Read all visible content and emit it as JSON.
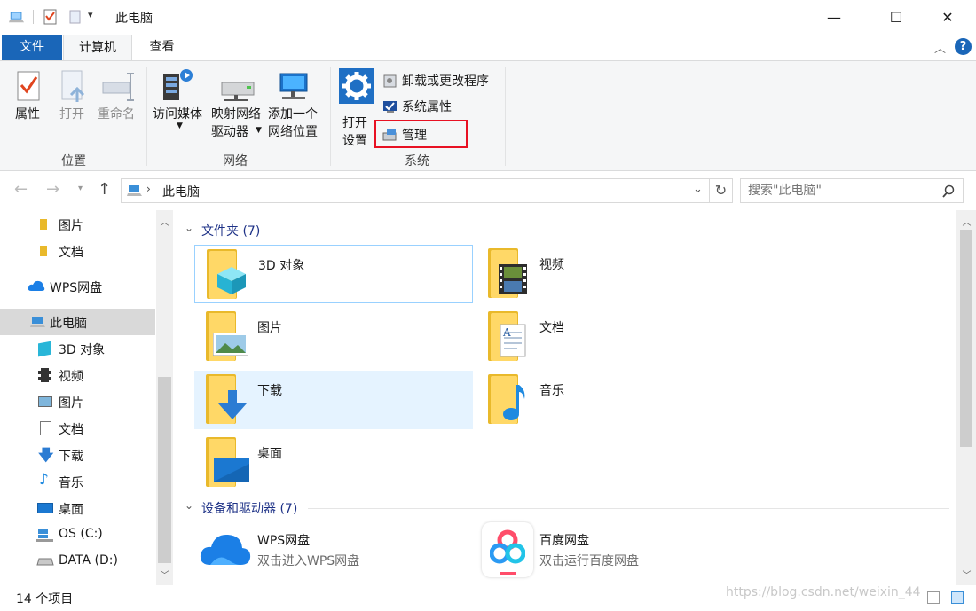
{
  "window": {
    "title": "此电脑",
    "minimize_glyph": "—",
    "maximize_glyph": "☐",
    "close_glyph": "✕"
  },
  "ribbon_tabs": [
    {
      "label": "文件"
    },
    {
      "label": "计算机"
    },
    {
      "label": "查看"
    }
  ],
  "ribbon": {
    "location_group": {
      "title": "位置",
      "properties": "属性",
      "open": "打开",
      "rename": "重命名"
    },
    "network_group": {
      "title": "网络",
      "access_media": "访问媒体",
      "map_drive_line1": "映射网络",
      "map_drive_line2": "驱动器",
      "add_location_line1": "添加一个",
      "add_location_line2": "网络位置"
    },
    "system_group": {
      "title": "系统",
      "open_settings_line1": "打开",
      "open_settings_line2": "设置",
      "uninstall": "卸载或更改程序",
      "system_properties": "系统属性",
      "manage": "管理"
    },
    "highlight_color": "#e81123"
  },
  "address": {
    "path": "此电脑",
    "search_placeholder": "搜索\"此电脑\""
  },
  "nav_pane": {
    "items": [
      {
        "label": "图片"
      },
      {
        "label": "文档"
      },
      {
        "label": "WPS网盘"
      },
      {
        "label": "此电脑"
      },
      {
        "label": "3D 对象"
      },
      {
        "label": "视频"
      },
      {
        "label": "图片"
      },
      {
        "label": "文档"
      },
      {
        "label": "下载"
      },
      {
        "label": "音乐"
      },
      {
        "label": "桌面"
      },
      {
        "label": "OS (C:)"
      },
      {
        "label": "DATA (D:)"
      }
    ]
  },
  "content": {
    "folders_header": "文件夹 (7)",
    "folders": [
      {
        "name": "3D 对象"
      },
      {
        "name": "视频"
      },
      {
        "name": "图片"
      },
      {
        "name": "文档"
      },
      {
        "name": "下载"
      },
      {
        "name": "音乐"
      },
      {
        "name": "桌面"
      }
    ],
    "devices_header": "设备和驱动器 (7)",
    "devices": [
      {
        "name": "WPS网盘",
        "sub": "双击进入WPS网盘"
      },
      {
        "name": "百度网盘",
        "sub": "双击运行百度网盘"
      }
    ]
  },
  "status": {
    "item_count": "14 个项目",
    "watermark": "https://blog.csdn.net/weixin_44"
  },
  "colors": {
    "accent": "#1a66b8",
    "folder": "#ffd867",
    "selection": "#e5f3ff",
    "focus_border": "#99d1ff"
  }
}
